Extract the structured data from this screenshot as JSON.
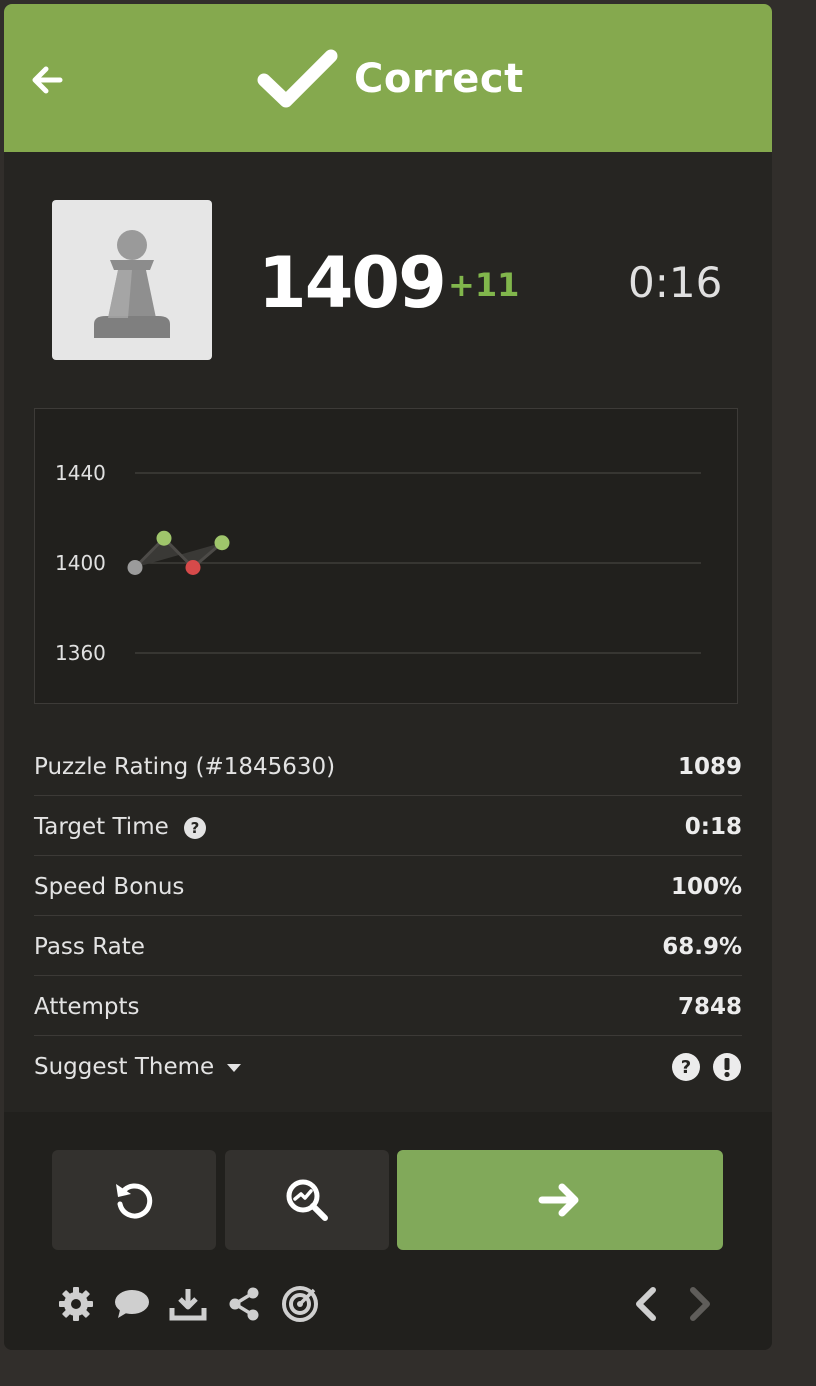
{
  "header": {
    "title": "Correct",
    "color": "#85a94e"
  },
  "player": {
    "avatar_icon": "pawn-avatar",
    "rating": "1409",
    "rating_delta": "+11",
    "timer": "0:16"
  },
  "chart_data": {
    "type": "line",
    "yticks": [
      "1440",
      "1400",
      "1360"
    ],
    "ylim": [
      1360,
      1440
    ],
    "grid": true,
    "points": [
      {
        "x": 1,
        "y": 1398,
        "result": "neutral",
        "color": "#9b9b9b"
      },
      {
        "x": 2,
        "y": 1411,
        "result": "win",
        "color": "#9fc56b"
      },
      {
        "x": 3,
        "y": 1398,
        "result": "loss",
        "color": "#d64a4a"
      },
      {
        "x": 4,
        "y": 1409,
        "result": "win",
        "color": "#9fc56b"
      }
    ]
  },
  "stats": [
    {
      "label": "Puzzle Rating (#1845630)",
      "value": "1089"
    },
    {
      "label": "Target Time",
      "value": "0:18"
    },
    {
      "label": "Speed Bonus",
      "value": "100%"
    },
    {
      "label": "Pass Rate",
      "value": "68.9%"
    },
    {
      "label": "Attempts",
      "value": "7848"
    }
  ],
  "suggest_theme": {
    "label": "Suggest Theme"
  },
  "icons": {
    "back": "arrow-left-icon",
    "check": "checkmark-icon",
    "retry": "retry-icon",
    "analyze": "analysis-icon",
    "next": "arrow-right-icon",
    "settings": "gear-icon",
    "chat": "chat-icon",
    "download": "download-icon",
    "share": "share-icon",
    "target": "target-icon"
  },
  "colors": {
    "accent": "#81b64c",
    "next_button": "#81a95a",
    "loss": "#d64a4a"
  }
}
